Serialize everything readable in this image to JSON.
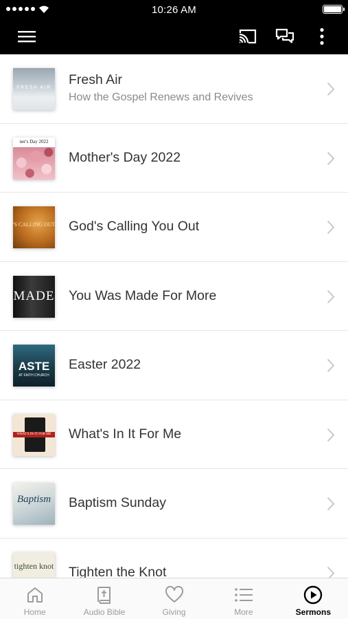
{
  "status_bar": {
    "time": "10:26 AM"
  },
  "header": {
    "menu_icon": "hamburger-menu-icon",
    "cast_icon": "cast-icon",
    "chat_icon": "chat-bubbles-icon",
    "more_icon": "vertical-ellipsis-icon"
  },
  "sermons": [
    {
      "title": "Fresh Air",
      "subtitle": "How the Gospel Renews and Revives",
      "thumb_text": "FRESH AIR"
    },
    {
      "title": "Mother's Day 2022",
      "subtitle": "",
      "thumb_text": "ner's Day 2022"
    },
    {
      "title": "God's Calling You Out",
      "subtitle": "",
      "thumb_text": "'S CALLING OUT"
    },
    {
      "title": "You Was Made For More",
      "subtitle": "",
      "thumb_text": "MADE"
    },
    {
      "title": "Easter 2022",
      "subtitle": "",
      "thumb_text": "ASTE",
      "thumb_subtext": "AT FAITH CHURCH"
    },
    {
      "title": "What's In It For Me",
      "subtitle": "",
      "thumb_text": "WHAT'S IN IT FOR ME"
    },
    {
      "title": "Baptism Sunday",
      "subtitle": "",
      "thumb_text": "Baptism"
    },
    {
      "title": "Tighten the Knot",
      "subtitle": "",
      "thumb_text": "tighten knot"
    }
  ],
  "tabs": [
    {
      "label": "Home",
      "icon": "home-icon",
      "active": false
    },
    {
      "label": "Audio Bible",
      "icon": "bible-icon",
      "active": false
    },
    {
      "label": "Giving",
      "icon": "heart-icon",
      "active": false
    },
    {
      "label": "More",
      "icon": "list-icon",
      "active": false
    },
    {
      "label": "Sermons",
      "icon": "play-circle-icon",
      "active": true
    }
  ],
  "colors": {
    "header_bg": "#000000",
    "tab_active": "#000000",
    "tab_inactive": "#9b9b9b",
    "title_text": "#333333",
    "subtitle_text": "#8a8a8a"
  }
}
